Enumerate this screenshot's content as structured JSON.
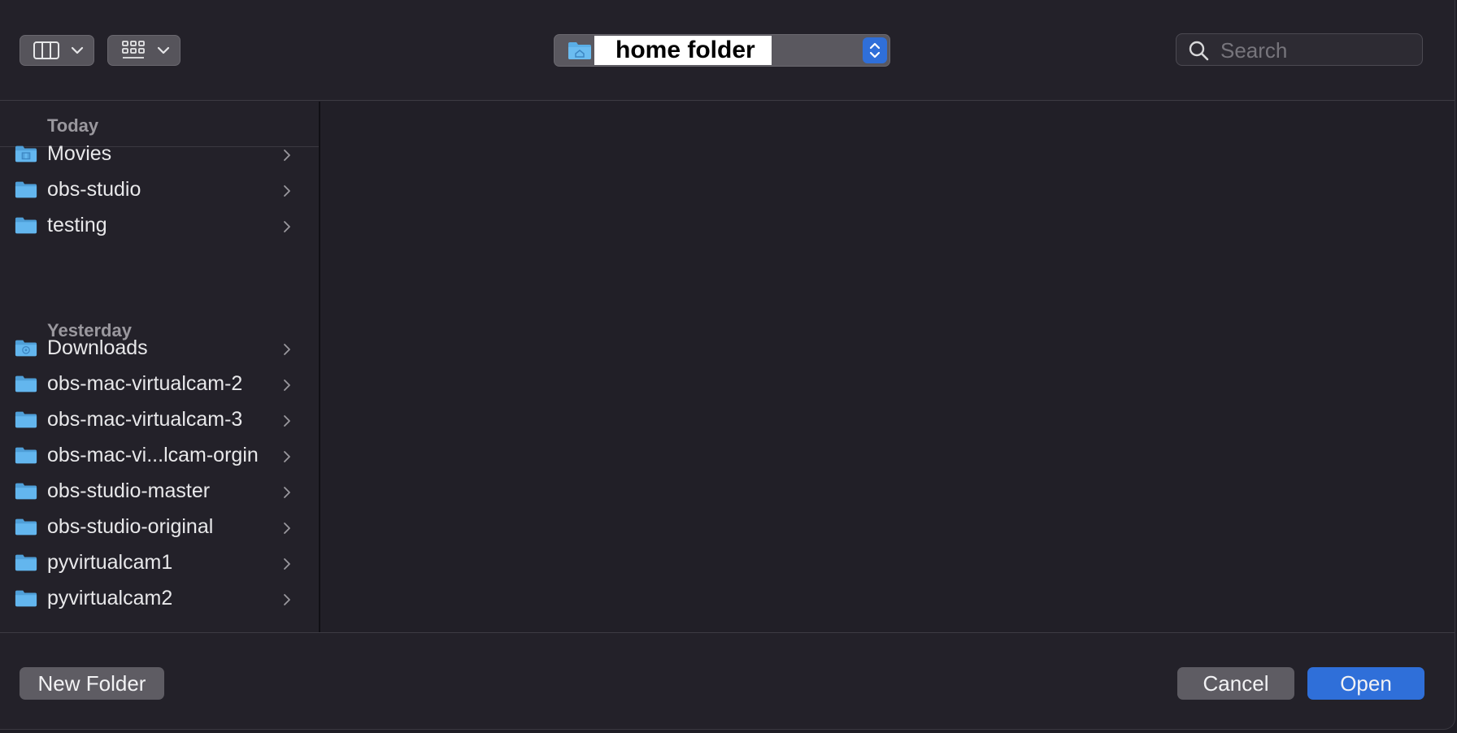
{
  "toolbar": {
    "view_mode_icon": "columns-icon",
    "group_icon": "grid-icon",
    "path": {
      "label": "home folder",
      "icon": "home-folder-icon"
    },
    "search": {
      "placeholder": "Search",
      "value": ""
    }
  },
  "sidebar": {
    "sections": [
      {
        "heading": "Today",
        "items": [
          {
            "label": "Movies",
            "icon": "movies-folder-icon"
          },
          {
            "label": "obs-studio",
            "icon": "folder-icon"
          },
          {
            "label": "testing",
            "icon": "folder-icon"
          }
        ]
      },
      {
        "heading": "Yesterday",
        "items": [
          {
            "label": "Downloads",
            "icon": "downloads-folder-icon"
          },
          {
            "label": "obs-mac-virtualcam-2",
            "icon": "folder-icon"
          },
          {
            "label": "obs-mac-virtualcam-3",
            "icon": "folder-icon"
          },
          {
            "label": "obs-mac-vi...lcam-orgin",
            "icon": "folder-icon"
          },
          {
            "label": "obs-studio-master",
            "icon": "folder-icon"
          },
          {
            "label": "obs-studio-original",
            "icon": "folder-icon"
          },
          {
            "label": "pyvirtualcam1",
            "icon": "folder-icon"
          },
          {
            "label": "pyvirtualcam2",
            "icon": "folder-icon"
          }
        ]
      }
    ]
  },
  "footer": {
    "new_folder_label": "New Folder",
    "cancel_label": "Cancel",
    "open_label": "Open"
  },
  "colors": {
    "background": "#232129",
    "accent": "#2f6fd9",
    "folder": "#5aaee6",
    "button": "#5e5c63"
  }
}
